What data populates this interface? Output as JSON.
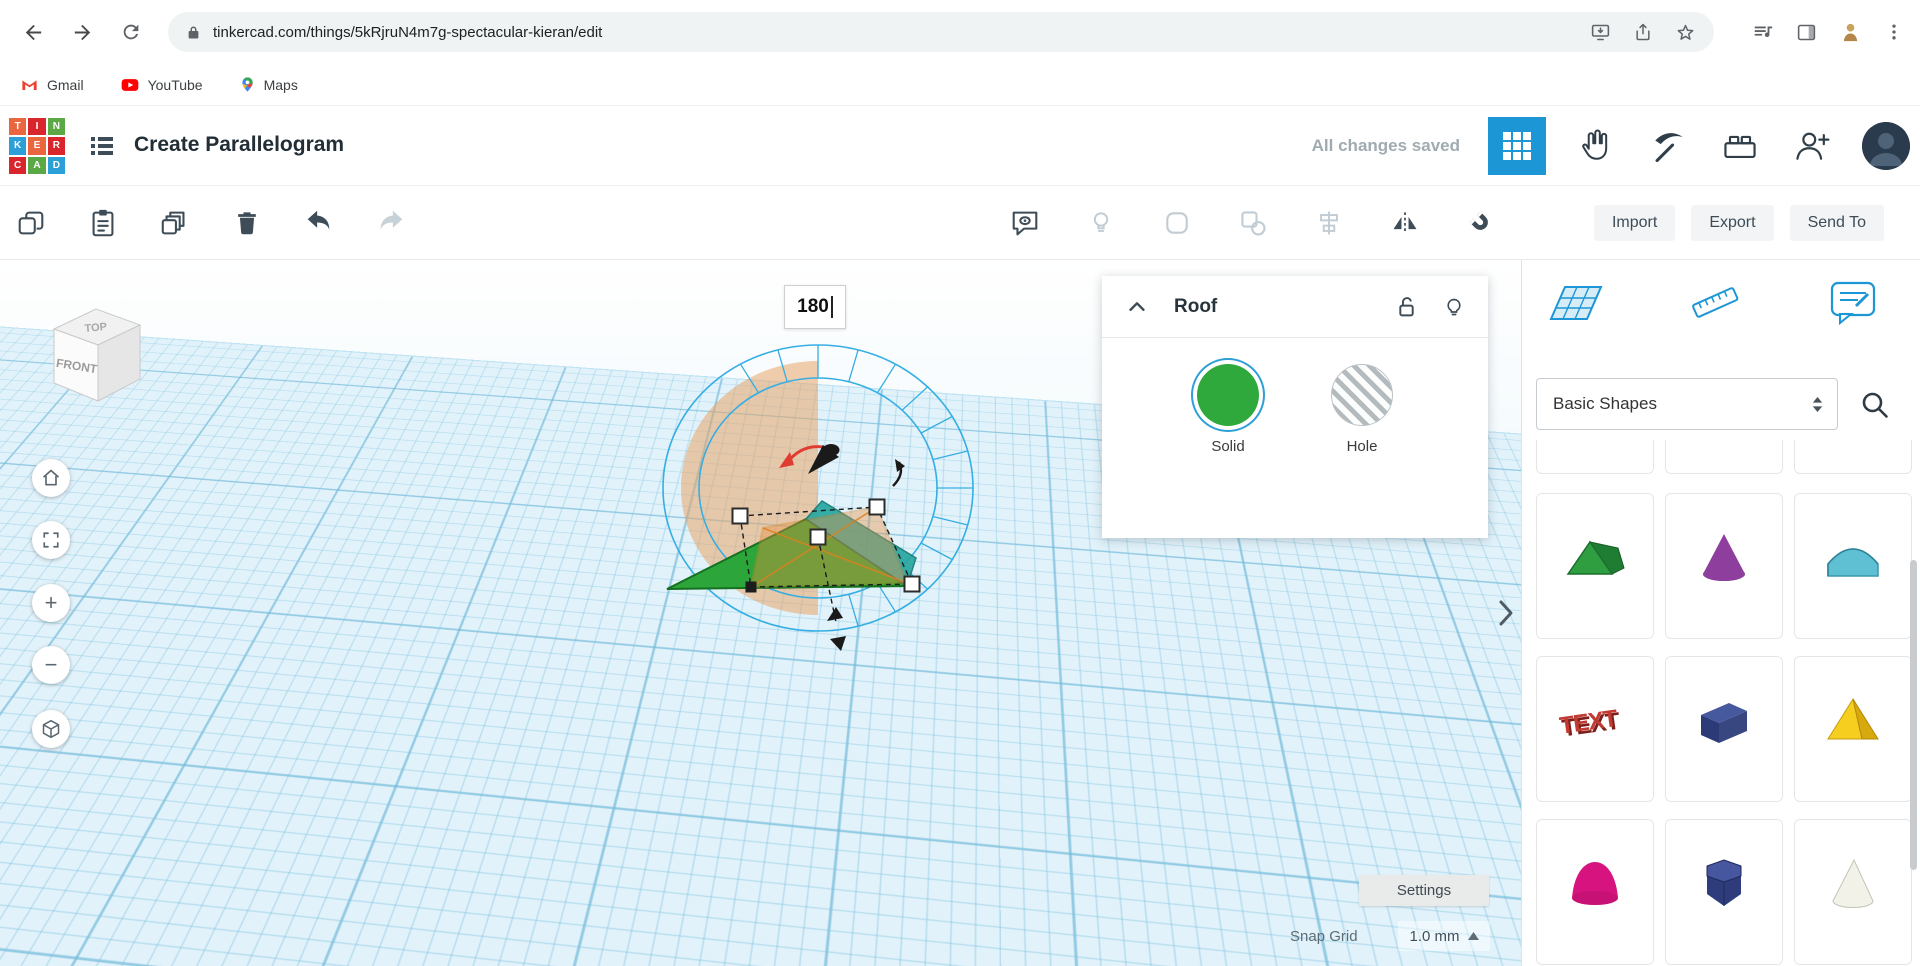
{
  "browser": {
    "url": "tinkercad.com/things/5kRjruN4m7g-spectacular-kieran/edit",
    "bookmarks": [
      {
        "label": "Gmail"
      },
      {
        "label": "YouTube"
      },
      {
        "label": "Maps"
      }
    ]
  },
  "app_header": {
    "logo_letters": [
      "T",
      "I",
      "N",
      "K",
      "E",
      "R",
      "C",
      "A",
      "D"
    ],
    "title": "Create Parallelogram",
    "save_status": "All changes saved"
  },
  "toolbar": {
    "import_label": "Import",
    "export_label": "Export",
    "send_to_label": "Send To"
  },
  "viewport": {
    "rotation_value": "180",
    "view_cube_top": "TOP",
    "view_cube_front": "FRONT",
    "settings_label": "Settings",
    "snap_grid_label": "Snap Grid",
    "snap_grid_value": "1.0 mm"
  },
  "shape_panel": {
    "title": "Roof",
    "solid_label": "Solid",
    "hole_label": "Hole"
  },
  "sidebar": {
    "category_value": "Basic Shapes",
    "text_shape_label": "TEXT",
    "shapes": [
      "roof",
      "cone",
      "round-roof",
      "text",
      "box",
      "pyramid",
      "paraboloid",
      "polygon",
      "soft-cone"
    ]
  },
  "colors": {
    "tinkercad_blue": "#1c96d4",
    "selection_blue": "#35aee3",
    "solid_green": "#2fa93c",
    "rotation_orange": "#e8a468"
  }
}
